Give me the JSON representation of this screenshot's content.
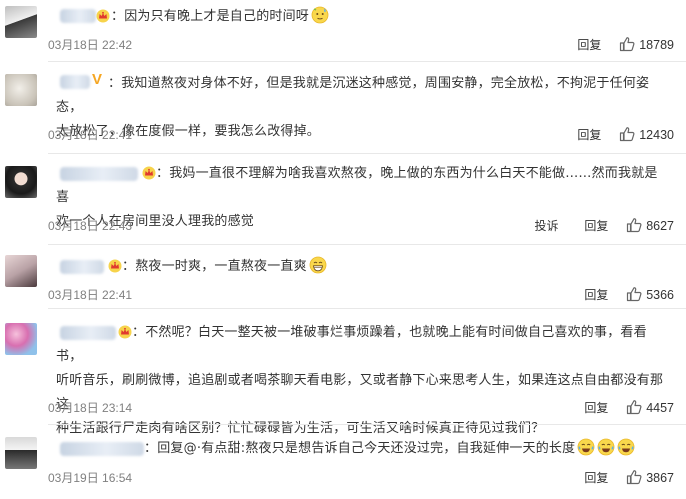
{
  "comments": [
    {
      "text": "因为只有晚上才是自己的时间呀",
      "time": "03月18日 22:42",
      "reply": "回复",
      "likes": "18789",
      "report": ""
    },
    {
      "text1": "我知道熬夜对身体不好，但是我就是沉迷这种感觉，周围安静，完全放松，不拘泥于任何姿态，",
      "text2": "太放松了，像在度假一样，要我怎么改得掉。",
      "time": "03月18日 22:41",
      "reply": "回复",
      "likes": "12430"
    },
    {
      "text1": "我妈一直很不理解为啥我喜欢熬夜，晚上做的东西为什么白天不能做……然而我就是喜",
      "text2": "欢一个人在房间里没人理我的感觉",
      "time": "03月18日 22:43",
      "report": "投诉",
      "reply": "回复",
      "likes": "8627"
    },
    {
      "text": "熬夜一时爽，一直熬夜一直爽",
      "time": "03月18日 22:41",
      "reply": "回复",
      "likes": "5366"
    },
    {
      "text1": "不然呢？白天一整天被一堆破事烂事烦躁着，也就晚上能有时间做自己喜欢的事，看看书，",
      "text2": "听听音乐，刷刷微博，追追剧或者喝茶聊天看电影，又或者静下心来思考人生，如果连这点自由都没有那这",
      "text3": "种生活跟行尸走肉有啥区别？忙忙碌碌皆为生活，可生活又啥时候真正待见过我们？",
      "time": "03月18日 23:14",
      "reply": "回复",
      "likes": "4457"
    },
    {
      "reply_prefix": "回复@",
      "reply_target": "·有点甜",
      "text": ":熬夜只是想告诉自己今天还没过完，自我延伸一天的长度",
      "time": "03月19日 16:54",
      "reply": "回复",
      "likes": "3867"
    }
  ],
  "icons": {
    "like": "thumbs-up-icon",
    "vip": "vip-crown-icon",
    "verified": "verified-v-icon",
    "emoji_thinking": "emoji-sweat-icon",
    "emoji_laugh": "emoji-grin-icon",
    "emoji_cry_laugh": "emoji-tears-of-joy-icon"
  },
  "colors": {
    "time": "#808080",
    "divider": "#e8e8e8",
    "verified": "#f5a623"
  }
}
